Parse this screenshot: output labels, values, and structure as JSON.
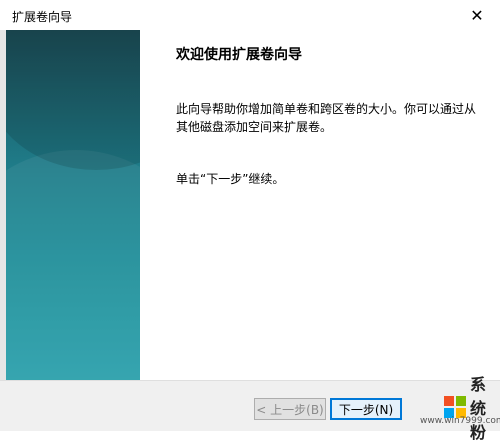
{
  "window": {
    "title": "扩展卷向导",
    "close_glyph": "✕"
  },
  "content": {
    "heading": "欢迎使用扩展卷向导",
    "description": "此向导帮助你增加简单卷和跨区卷的大小。你可以通过从其他磁盘添加空间来扩展卷。",
    "instruction": "单击“下一步”继续。"
  },
  "footer": {
    "back_label": "< 上一步(B)",
    "next_label": "下一步(N)"
  },
  "watermark": {
    "brand": "系统粉",
    "url": "www.win7999.com",
    "logo_colors": [
      "#f25022",
      "#7fba00",
      "#00a4ef",
      "#ffb900"
    ]
  }
}
